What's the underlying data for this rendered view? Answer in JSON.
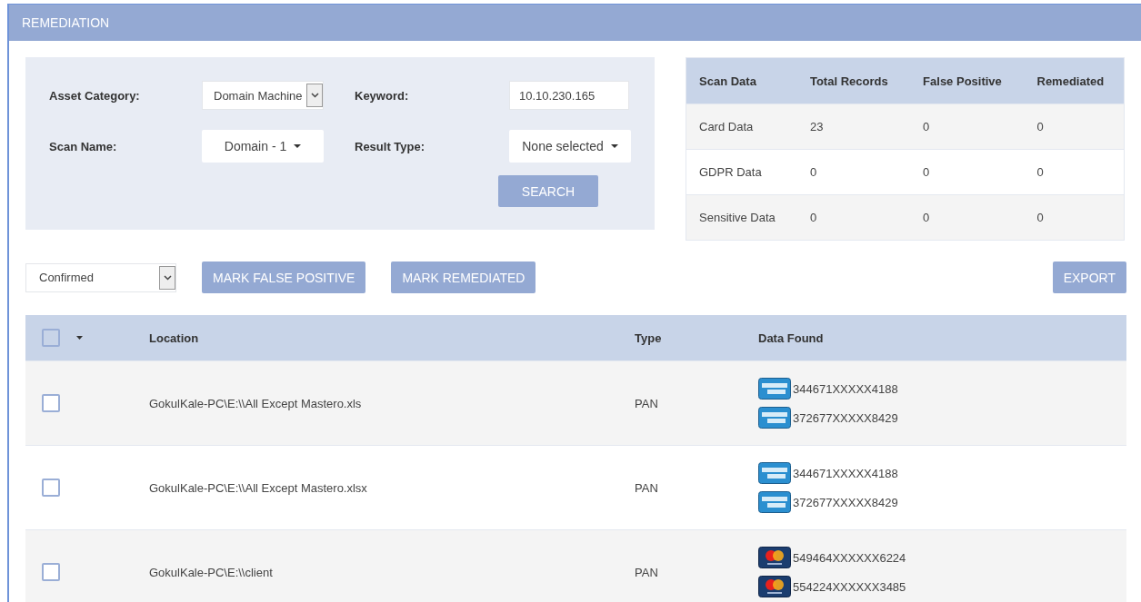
{
  "title": "REMEDIATION",
  "filters": [
    {
      "label": "Asset Category:",
      "kind": "select",
      "value": "Domain Machine"
    },
    {
      "label": "Keyword:",
      "kind": "input",
      "value": "10.10.230.165"
    },
    {
      "label": "Scan Name:",
      "kind": "dropdown",
      "value": "Domain - 1"
    },
    {
      "label": "Result Type:",
      "kind": "dropdown",
      "value": "None selected"
    }
  ],
  "search_button": "SEARCH",
  "summary": {
    "columns": [
      "Scan Data",
      "Total Records",
      "False Positive",
      "Remediated"
    ],
    "rows": [
      [
        "Card Data",
        "23",
        "0",
        "0"
      ],
      [
        "GDPR Data",
        "0",
        "0",
        "0"
      ],
      [
        "Sensitive Data",
        "0",
        "0",
        "0"
      ]
    ]
  },
  "status_select": "Confirmed",
  "actions": [
    "MARK FALSE POSITIVE",
    "MARK REMEDIATED"
  ],
  "export_button": "EXPORT",
  "table": {
    "select_all_checked": false,
    "columns": [
      "Location",
      "Type",
      "Data Found"
    ],
    "rows": [
      {
        "checked": false,
        "location": "GokulKale-PC\\E:\\\\All Except Mastero.xls",
        "type": "PAN",
        "cards": [
          {
            "kind": "amex",
            "number": "344671XXXXX4188"
          },
          {
            "kind": "amex",
            "number": "372677XXXXX8429"
          }
        ]
      },
      {
        "checked": false,
        "location": "GokulKale-PC\\E:\\\\All Except Mastero.xlsx",
        "type": "PAN",
        "cards": [
          {
            "kind": "amex",
            "number": "344671XXXXX4188"
          },
          {
            "kind": "amex",
            "number": "372677XXXXX8429"
          }
        ]
      },
      {
        "checked": false,
        "location": "GokulKale-PC\\E:\\\\client",
        "type": "PAN",
        "cards": [
          {
            "kind": "mastercard",
            "number": "549464XXXXXX6224"
          },
          {
            "kind": "mastercard",
            "number": "554224XXXXXX3485"
          }
        ]
      }
    ]
  }
}
